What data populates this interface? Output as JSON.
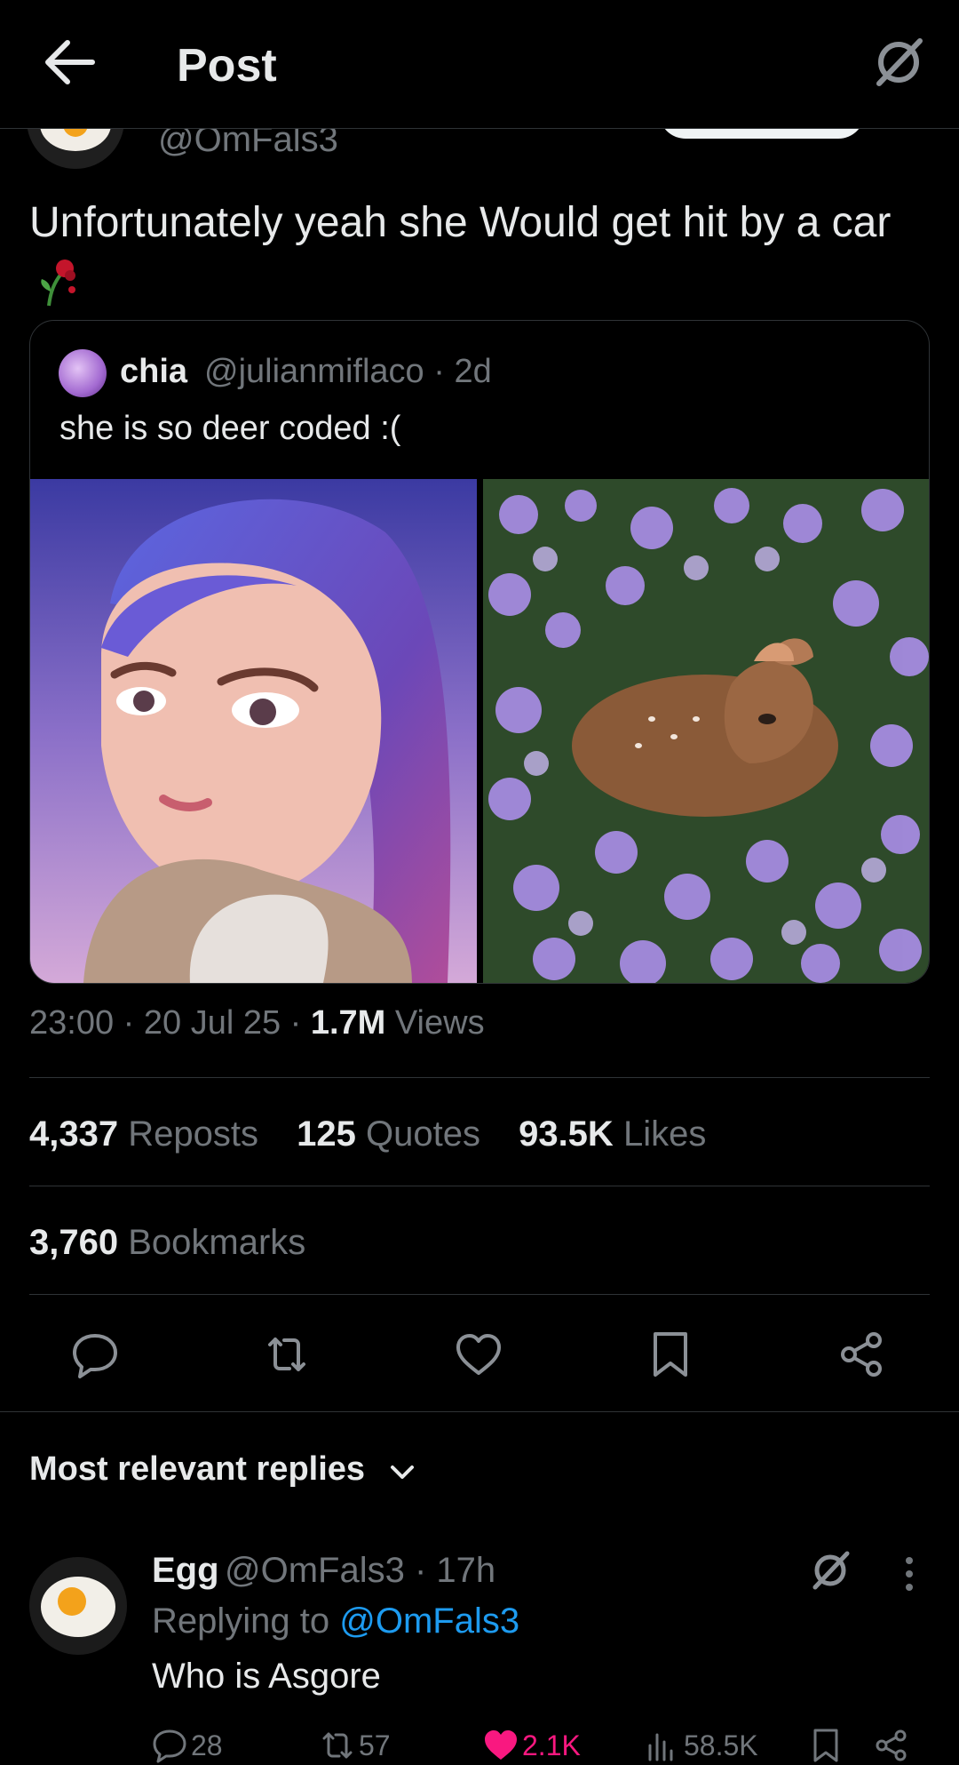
{
  "header": {
    "title": "Post"
  },
  "author": {
    "handle": "@OmFals3"
  },
  "tweet": {
    "text": "Unfortunately yeah she Would get hit by a car"
  },
  "quote": {
    "name": "chia",
    "handle_time": "@julianmiflaco · 2d",
    "text": "she is so deer coded :("
  },
  "meta": {
    "time": "23:00 · 20 Jul 25 · ",
    "views_count": "1.7M",
    "views_label": " Views"
  },
  "stats": {
    "reposts_count": "4,337",
    "reposts_label": "Reposts",
    "quotes_count": "125",
    "quotes_label": "Quotes",
    "likes_count": "93.5K",
    "likes_label": "Likes",
    "bookmarks_count": "3,760",
    "bookmarks_label": "Bookmarks"
  },
  "replies_section": {
    "label": "Most relevant replies"
  },
  "reply": {
    "name": "Egg",
    "handle_time": "@OmFals3 · 17h",
    "replying_prefix": "Replying to ",
    "replying_handle": "@OmFals3",
    "text": "Who is Asgore",
    "counts": {
      "replies": "28",
      "reposts": "57",
      "likes": "2.1K",
      "views": "58.5K"
    }
  },
  "colors": {
    "background": "#000000",
    "text": "#e7e9ea",
    "muted": "#71767b",
    "link": "#1d9bf0",
    "like": "#f91880",
    "divider": "#2f3336"
  }
}
